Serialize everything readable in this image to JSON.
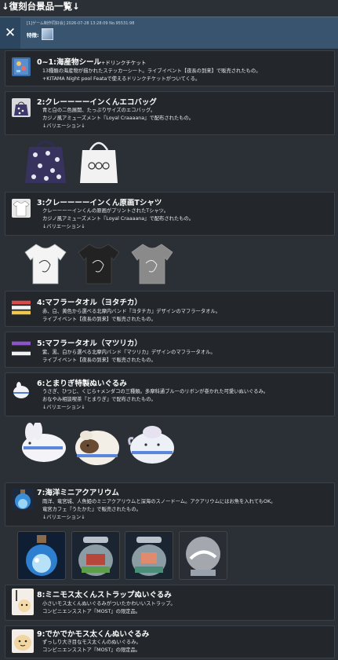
{
  "page": {
    "title": "↓復刻台景品一覧↓"
  },
  "topbar": {
    "meta": "[1]ゲーム制作同好会] 2026-07-28 13:28:09 No.95531:98",
    "tag": "特徴:",
    "close_glyph": "✕"
  },
  "items": [
    {
      "title": "0~1:海産物シール",
      "title_sub": "+ドリンクチケット",
      "lines": [
        "13種類の海産物が描かれたステッカーシート。ライブイベント【夜長の到来】で販売されたもの。",
        "+KITAMA Night pool Feataで使えるドリンクチケットがついてくる。"
      ]
    },
    {
      "title": "2:クレーーーーインくんエコバッグ",
      "lines": [
        "青と白の二色展開、たっぷりサイズのエコバッグ。",
        "カジノ風アミューズメント『Loyal Craaaana』で配布されたもの。",
        "↓バリエーション↓"
      ]
    },
    {
      "title": "3:クレーーーーインくん原画Tシャツ",
      "lines": [
        "クレーーーーインくんの原画がプリントされたTシャツ。",
        "カジノ風アミューズメント『Loyal Craaaana』で配布されたもの。",
        "↓バリエーション↓"
      ]
    },
    {
      "title": "4:マフラータオル（ヨタチカ）",
      "lines": [
        "赤、白、黄色から選べる北摩内バンド『ヨタチカ』デザインのマフラータオル。",
        "ライブイベント【夜長の到来】で販売されたもの。"
      ]
    },
    {
      "title": "5:マフラータオル（マツリカ）",
      "lines": [
        "紫、黒、白から選べる北摩内バンド『マツリカ』デザインのマフラータオル。",
        "ライブイベント【夜長の到来】で販売されたもの。"
      ]
    },
    {
      "title": "6:とまりぎ特製ぬいぐるみ",
      "lines": [
        "うさぎ、ひつじ、くじら+メンダコの三種類。多摩科通ブルーのリボンが巻かれた可愛いぬいぐるみ。",
        "おなやみ相談喫茶『とまりぎ』で配布されたもの。",
        "↓バリエーション↓"
      ]
    },
    {
      "title": "7:海洋ミニアクアリウム",
      "lines": [
        "雨洋、竜宮城、人魚姫のミニアクアリウムと深海のスノードーム。アクアリウムにはお魚を入れてもOK。",
        "竜宮カフェ『うたかた』で販売されたもの。",
        "↓バリエーション↓"
      ]
    },
    {
      "title": "8:ミニモス太くんストラップぬいぐるみ",
      "lines": [
        "小さいモス太くんぬいぐるみがついたかわいいストラップ。",
        "コンビニエンスストア『MOST』の限定品。"
      ]
    },
    {
      "title": "9:でかでかモス太くんぬいぐるみ",
      "lines": [
        "ずっしり大き目なモス太くんのぬいぐるみ。",
        "コンビニエンスストア『MOST』の限定品。"
      ]
    }
  ]
}
